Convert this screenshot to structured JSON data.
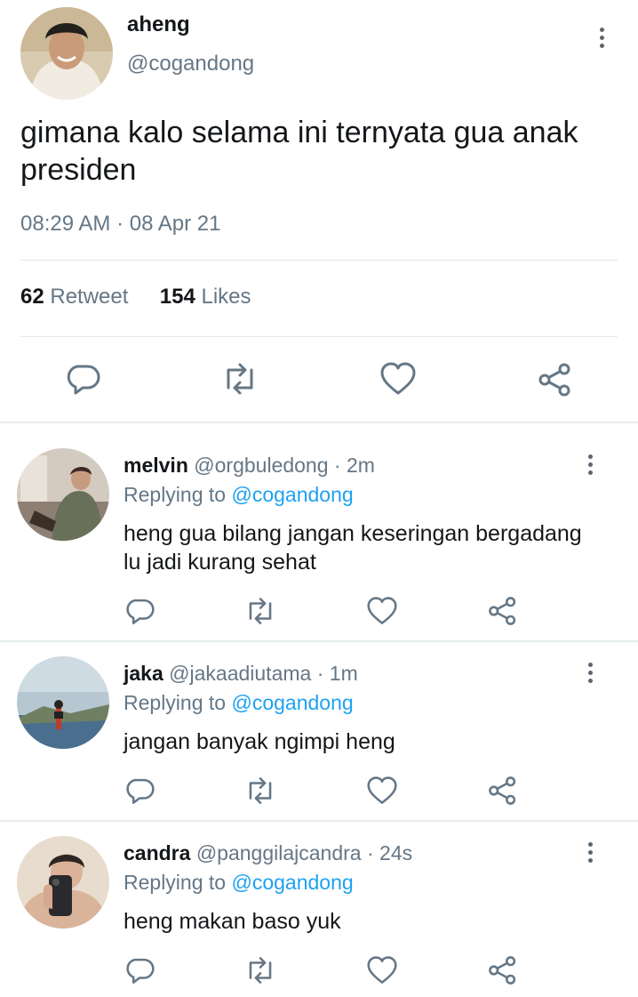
{
  "tweet": {
    "name": "aheng",
    "handle": "@cogandong",
    "text": "gimana kalo selama ini ternyata gua anak presiden",
    "time": "08:29 AM",
    "separator": " · ",
    "date": "08 Apr 21",
    "retweets": {
      "count": "62",
      "label": "Retweet"
    },
    "likes": {
      "count": "154",
      "label": "Likes"
    }
  },
  "replies": [
    {
      "name": "melvin",
      "handle": "@orgbuledong",
      "age": "2m",
      "replying_prefix": "Replying to",
      "replying_to": "@cogandong",
      "text": "heng gua bilang jangan keseringan bergadang lu jadi kurang sehat"
    },
    {
      "name": "jaka",
      "handle": "@jakaadiutama",
      "age": "1m",
      "replying_prefix": "Replying to",
      "replying_to": "@cogandong",
      "text": "jangan banyak ngimpi heng"
    },
    {
      "name": "candra",
      "handle": "@panggilajcandra",
      "age": "24s",
      "replying_prefix": "Replying to",
      "replying_to": "@cogandong",
      "text": "heng makan baso yuk"
    }
  ],
  "icons": {
    "reply": "reply-icon",
    "retweet": "retweet-icon",
    "like": "heart-icon",
    "share": "share-icon",
    "more": "more-vertical-icon"
  },
  "colors": {
    "text": "#14171a",
    "secondary": "#657786",
    "mention": "#1da1f2",
    "icon": "#657786",
    "divider": "#e1e8ed"
  }
}
